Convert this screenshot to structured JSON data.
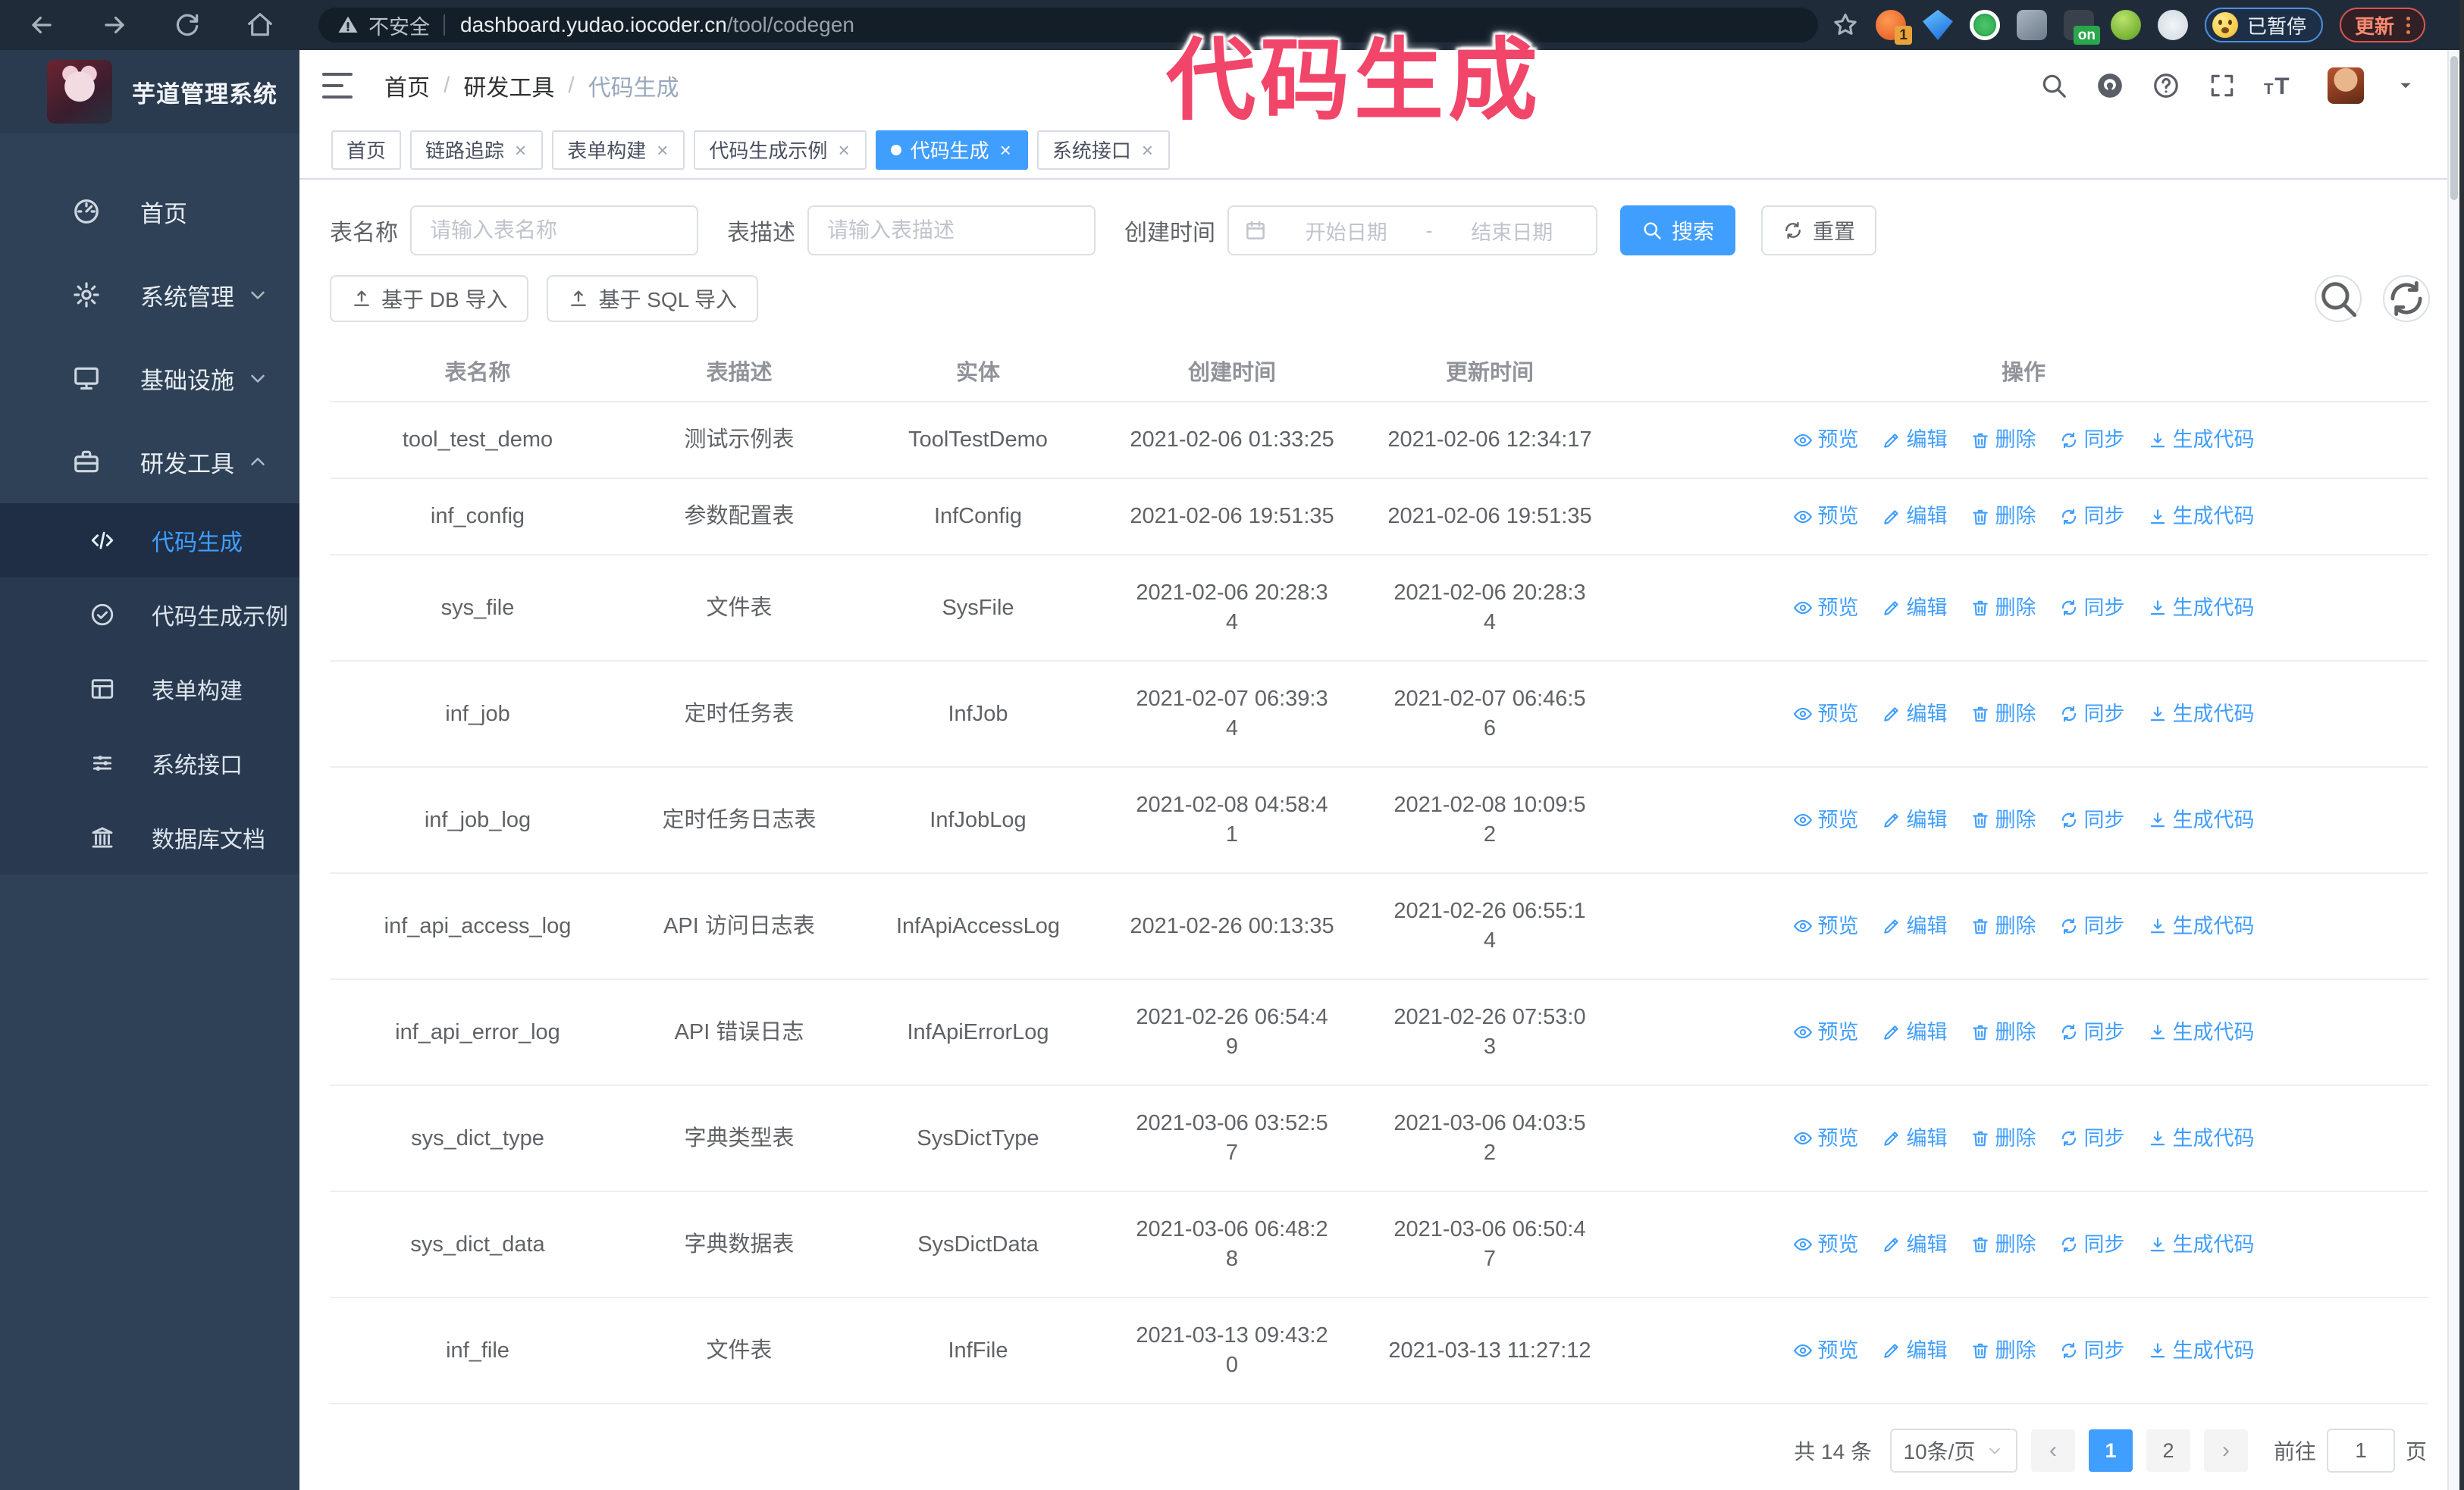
{
  "browser": {
    "security_label": "不安全",
    "url_host": "dashboard.yudao.iocoder.cn",
    "url_path": "/tool/codegen",
    "extension_badge": "1",
    "extension_on_badge": "on",
    "paused_badge": "已暂停",
    "update_button": "更新"
  },
  "annotation": {
    "text": "代码生成"
  },
  "sidebar": {
    "logo_title": "芋道管理系统",
    "items": [
      {
        "label": "首页",
        "icon": "dashboard"
      },
      {
        "label": "系统管理",
        "icon": "gear",
        "chevron": "down"
      },
      {
        "label": "基础设施",
        "icon": "monitor",
        "chevron": "down"
      },
      {
        "label": "研发工具",
        "icon": "toolbox",
        "chevron": "up",
        "children": [
          {
            "label": "代码生成",
            "icon": "code",
            "active": true
          },
          {
            "label": "代码生成示例",
            "icon": "shield-check"
          },
          {
            "label": "表单构建",
            "icon": "form"
          },
          {
            "label": "系统接口",
            "icon": "sliders"
          },
          {
            "label": "数据库文档",
            "icon": "db-doc"
          }
        ]
      }
    ]
  },
  "header": {
    "breadcrumb": [
      "首页",
      "研发工具",
      "代码生成"
    ]
  },
  "tabs": [
    {
      "label": "首页",
      "closable": false,
      "active": false
    },
    {
      "label": "链路追踪",
      "closable": true,
      "active": false
    },
    {
      "label": "表单构建",
      "closable": true,
      "active": false
    },
    {
      "label": "代码生成示例",
      "closable": true,
      "active": false
    },
    {
      "label": "代码生成",
      "closable": true,
      "active": true
    },
    {
      "label": "系统接口",
      "closable": true,
      "active": false
    }
  ],
  "search_form": {
    "table_name_label": "表名称",
    "table_name_placeholder": "请输入表名称",
    "table_desc_label": "表描述",
    "table_desc_placeholder": "请输入表描述",
    "create_time_label": "创建时间",
    "date_start_placeholder": "开始日期",
    "date_separator": "-",
    "date_end_placeholder": "结束日期",
    "search_button": "搜索",
    "reset_button": "重置"
  },
  "toolbar": {
    "import_db_button": "基于 DB 导入",
    "import_sql_button": "基于 SQL 导入"
  },
  "table": {
    "columns": [
      "表名称",
      "表描述",
      "实体",
      "创建时间",
      "更新时间",
      "操作"
    ],
    "actions": [
      "预览",
      "编辑",
      "删除",
      "同步",
      "生成代码"
    ],
    "rows": [
      {
        "name": "tool_test_demo",
        "desc": "测试示例表",
        "entity": "ToolTestDemo",
        "created": "2021-02-06 01:33:25",
        "updated": "2021-02-06 12:34:17"
      },
      {
        "name": "inf_config",
        "desc": "参数配置表",
        "entity": "InfConfig",
        "created": "2021-02-06 19:51:35",
        "updated": "2021-02-06 19:51:35"
      },
      {
        "name": "sys_file",
        "desc": "文件表",
        "entity": "SysFile",
        "created": "2021-02-06 20:28:3\n4",
        "updated": "2021-02-06 20:28:3\n4"
      },
      {
        "name": "inf_job",
        "desc": "定时任务表",
        "entity": "InfJob",
        "created": "2021-02-07 06:39:3\n4",
        "updated": "2021-02-07 06:46:5\n6"
      },
      {
        "name": "inf_job_log",
        "desc": "定时任务日志表",
        "entity": "InfJobLog",
        "created": "2021-02-08 04:58:4\n1",
        "updated": "2021-02-08 10:09:5\n2"
      },
      {
        "name": "inf_api_access_log",
        "desc": "API 访问日志表",
        "entity": "InfApiAccessLog",
        "created": "2021-02-26 00:13:35",
        "updated": "2021-02-26 06:55:1\n4"
      },
      {
        "name": "inf_api_error_log",
        "desc": "API 错误日志",
        "entity": "InfApiErrorLog",
        "created": "2021-02-26 06:54:4\n9",
        "updated": "2021-02-26 07:53:0\n3"
      },
      {
        "name": "sys_dict_type",
        "desc": "字典类型表",
        "entity": "SysDictType",
        "created": "2021-03-06 03:52:5\n7",
        "updated": "2021-03-06 04:03:5\n2"
      },
      {
        "name": "sys_dict_data",
        "desc": "字典数据表",
        "entity": "SysDictData",
        "created": "2021-03-06 06:48:2\n8",
        "updated": "2021-03-06 06:50:4\n7"
      },
      {
        "name": "inf_file",
        "desc": "文件表",
        "entity": "InfFile",
        "created": "2021-03-13 09:43:2\n0",
        "updated": "2021-03-13 11:27:12"
      }
    ]
  },
  "pagination": {
    "total_label": "共 14 条",
    "page_size": "10条/页",
    "pages": [
      "1",
      "2"
    ],
    "active_page": "1",
    "goto_label": "前往",
    "goto_value": "1",
    "page_suffix": "页"
  },
  "colors": {
    "accent": "#409eff",
    "sidebar_bg": "#2f4156",
    "annotation": "#f2456a",
    "active_tab_bg": "#409eff"
  }
}
